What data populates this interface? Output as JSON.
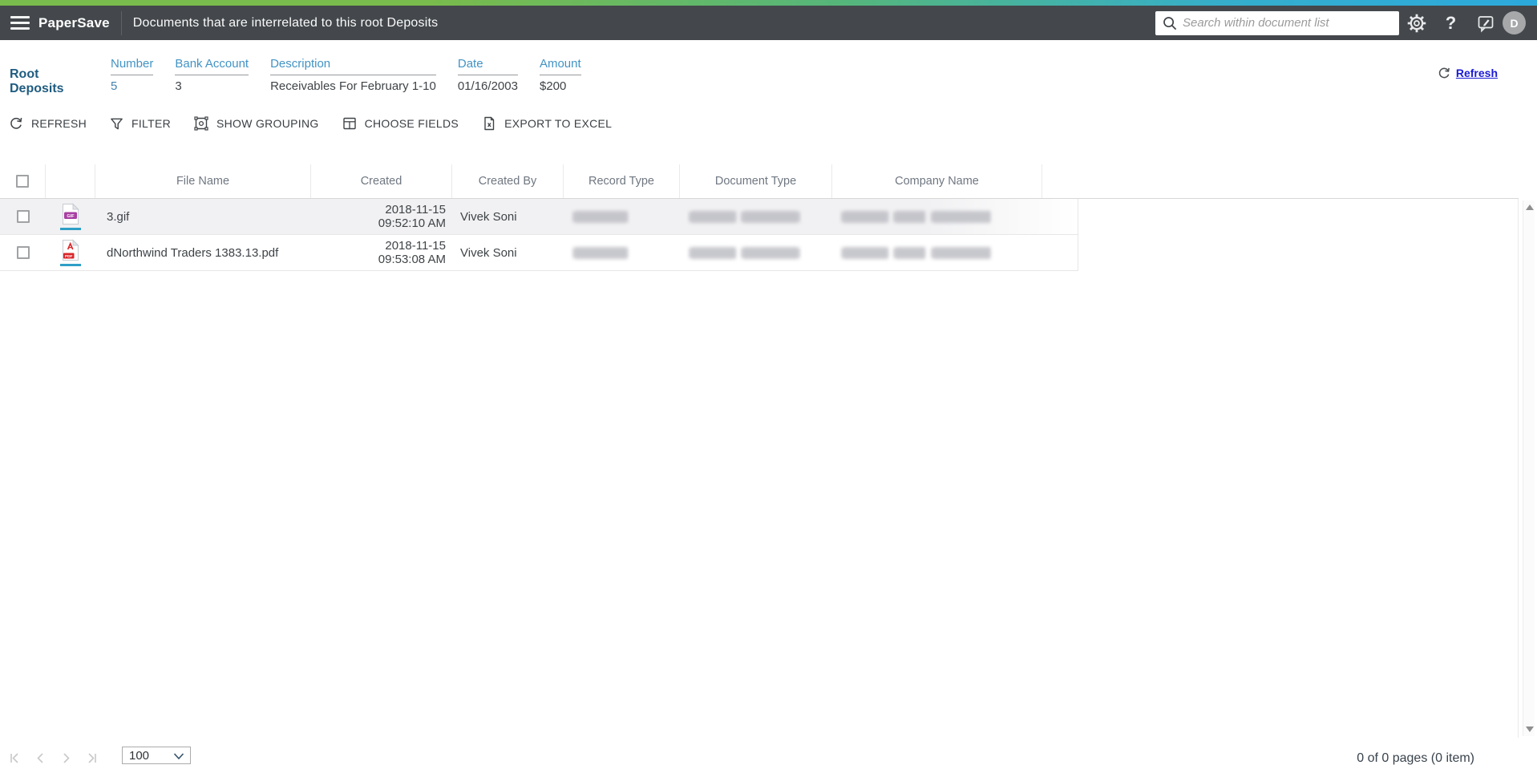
{
  "topbar": {
    "brand": "PaperSave",
    "title": "Documents that are interrelated to this root Deposits",
    "search_placeholder": "Search within document list",
    "help_glyph": "?",
    "avatar_initial": "D"
  },
  "record_header": {
    "title": "Root Deposits",
    "fields": [
      {
        "label": "Number",
        "value": "5"
      },
      {
        "label": "Bank Account",
        "value": "3"
      },
      {
        "label": "Description",
        "value": "Receivables For February 1-10"
      },
      {
        "label": "Date",
        "value": "01/16/2003"
      },
      {
        "label": "Amount",
        "value": "$200"
      }
    ],
    "refresh_label": "Refresh"
  },
  "toolbar": {
    "refresh": "REFRESH",
    "filter": "FILTER",
    "show_grouping": "SHOW GROUPING",
    "choose_fields": "CHOOSE FIELDS",
    "export_excel": "EXPORT TO EXCEL"
  },
  "grid": {
    "columns": {
      "file_name": "File Name",
      "created": "Created",
      "created_by": "Created By",
      "record_type": "Record Type",
      "document_type": "Document Type",
      "company_name": "Company Name"
    },
    "blurred_columns": [
      "Record Type",
      "Document Type",
      "Company Name"
    ],
    "rows": [
      {
        "file_name": "3.gif",
        "file_badge": "GIF",
        "created_date": "2018-11-15",
        "created_time": "09:52:10 AM",
        "created_by": "Vivek Soni",
        "record_type_blurred": true,
        "document_type_blurred": true,
        "company_name_blurred": true
      },
      {
        "file_name": "dNorthwind Traders 1383.13.pdf",
        "file_badge": "PDF",
        "created_date": "2018-11-15",
        "created_time": "09:53:08 AM",
        "created_by": "Vivek Soni",
        "record_type_blurred": true,
        "document_type_blurred": true,
        "company_name_blurred": true
      }
    ]
  },
  "pagination": {
    "page_size": "100",
    "summary": "0 of 0 pages (0 item)"
  },
  "colors": {
    "accent_gradient_left": "#79BB4C",
    "accent_gradient_right": "#2CA9DC",
    "topbar_bg": "#44484C",
    "field_label_blue": "#4293C4",
    "record_title_blue": "#1F5C80",
    "refresh_link_blue": "#1A1AD6",
    "file_underline_teal": "#2F9FC6",
    "gif_icon_purple": "#A73FA3",
    "pdf_icon_red": "#D9252A"
  }
}
